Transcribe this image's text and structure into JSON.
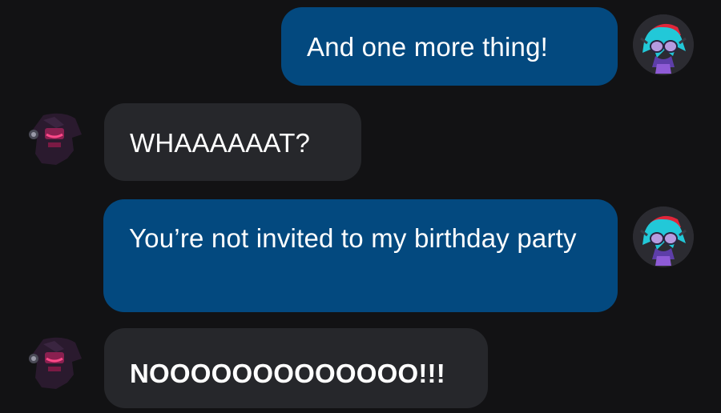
{
  "messages": [
    {
      "side": "sent",
      "text": "And one more thing!"
    },
    {
      "side": "received",
      "text": "WHAAAAAAT?"
    },
    {
      "side": "sent",
      "text": "You’re not invited to my birthday party"
    },
    {
      "side": "received",
      "text": "NOOOOOOOOOOOOO!!!"
    }
  ],
  "avatars": {
    "sender_icon": "cyan-haired-character-avatar",
    "receiver_icon": "shadow-character-avatar"
  },
  "colors": {
    "background": "#121214",
    "sent_bubble": "#03497f",
    "received_bubble": "#26272b",
    "text": "#ffffff"
  }
}
